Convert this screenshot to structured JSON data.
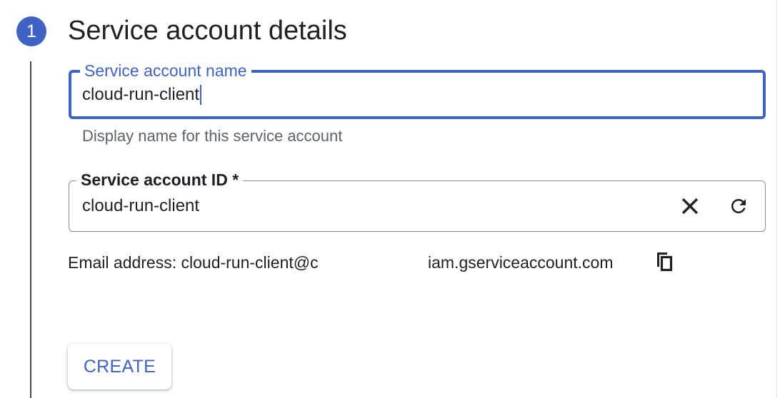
{
  "step": {
    "number": "1",
    "title": "Service account details"
  },
  "service_account_name": {
    "label": "Service account name",
    "value": "cloud-run-client",
    "helper_text": "Display name for this service account"
  },
  "service_account_id": {
    "label": "Service account ID *",
    "value": "cloud-run-client",
    "clear_icon": "close-icon",
    "refresh_icon": "refresh-icon"
  },
  "email": {
    "text_left": "Email address: cloud-run-client@c",
    "text_right": "iam.gserviceaccount.com",
    "copy_icon": "copy-icon"
  },
  "actions": {
    "create_label": "CREATE"
  },
  "colors": {
    "accent": "#3f63c4",
    "text": "#202124",
    "helper": "#5f6368",
    "outline": "#8a8f96"
  }
}
